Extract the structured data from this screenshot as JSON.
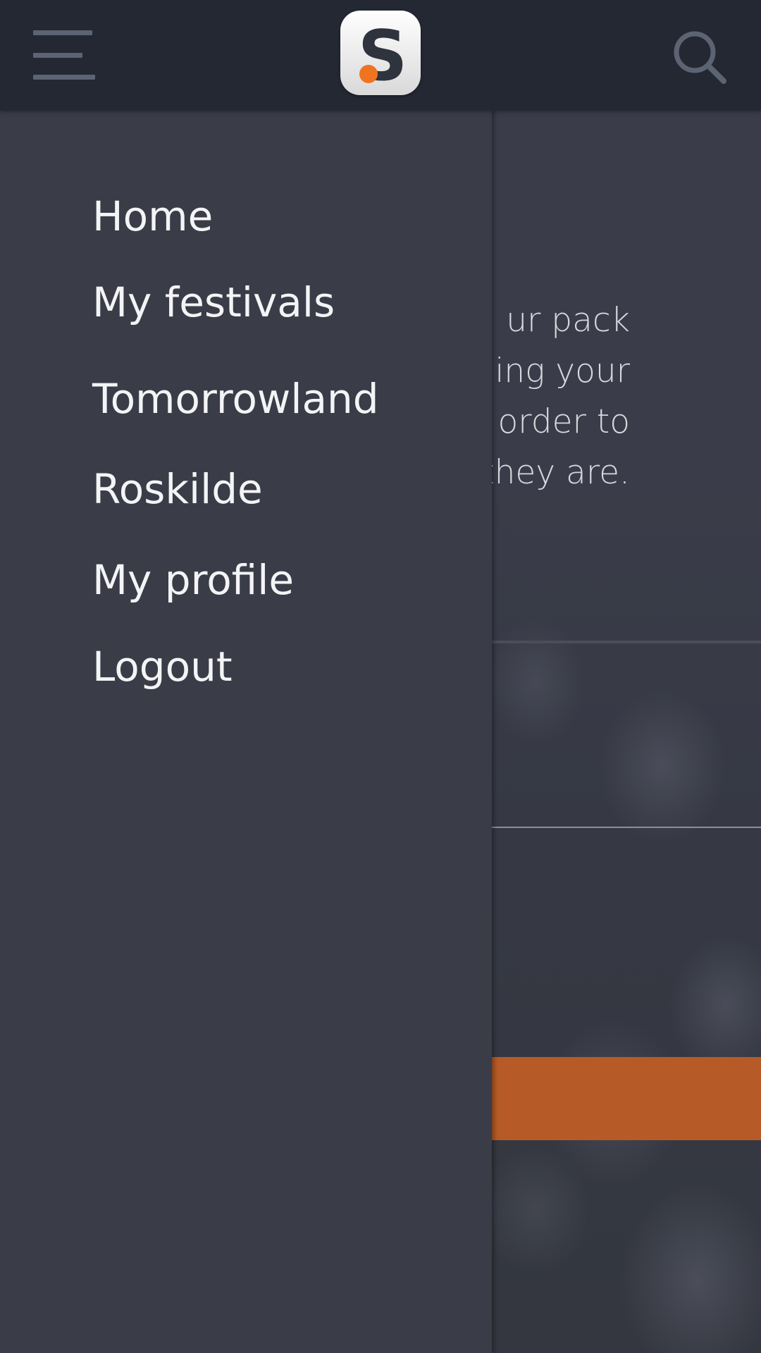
{
  "colors": {
    "topbar_bg": "#232833",
    "drawer_bg": "#3a3d48",
    "accent": "#f07320",
    "nav_text": "#f4f4f6",
    "icon_gray": "#5c6473"
  },
  "header": {
    "menu_icon": "hamburger-menu-icon",
    "logo_letter": "S",
    "search_icon": "search-icon"
  },
  "drawer": {
    "items": [
      {
        "label": "Home"
      },
      {
        "label": "My festivals"
      },
      {
        "label": "Tomorrowland"
      },
      {
        "label": "Roskilde"
      },
      {
        "label": "My profile"
      },
      {
        "label": "Logout"
      }
    ]
  },
  "background": {
    "text_lines": [
      "ur pack",
      "ding your",
      "n order to",
      "they are."
    ]
  }
}
